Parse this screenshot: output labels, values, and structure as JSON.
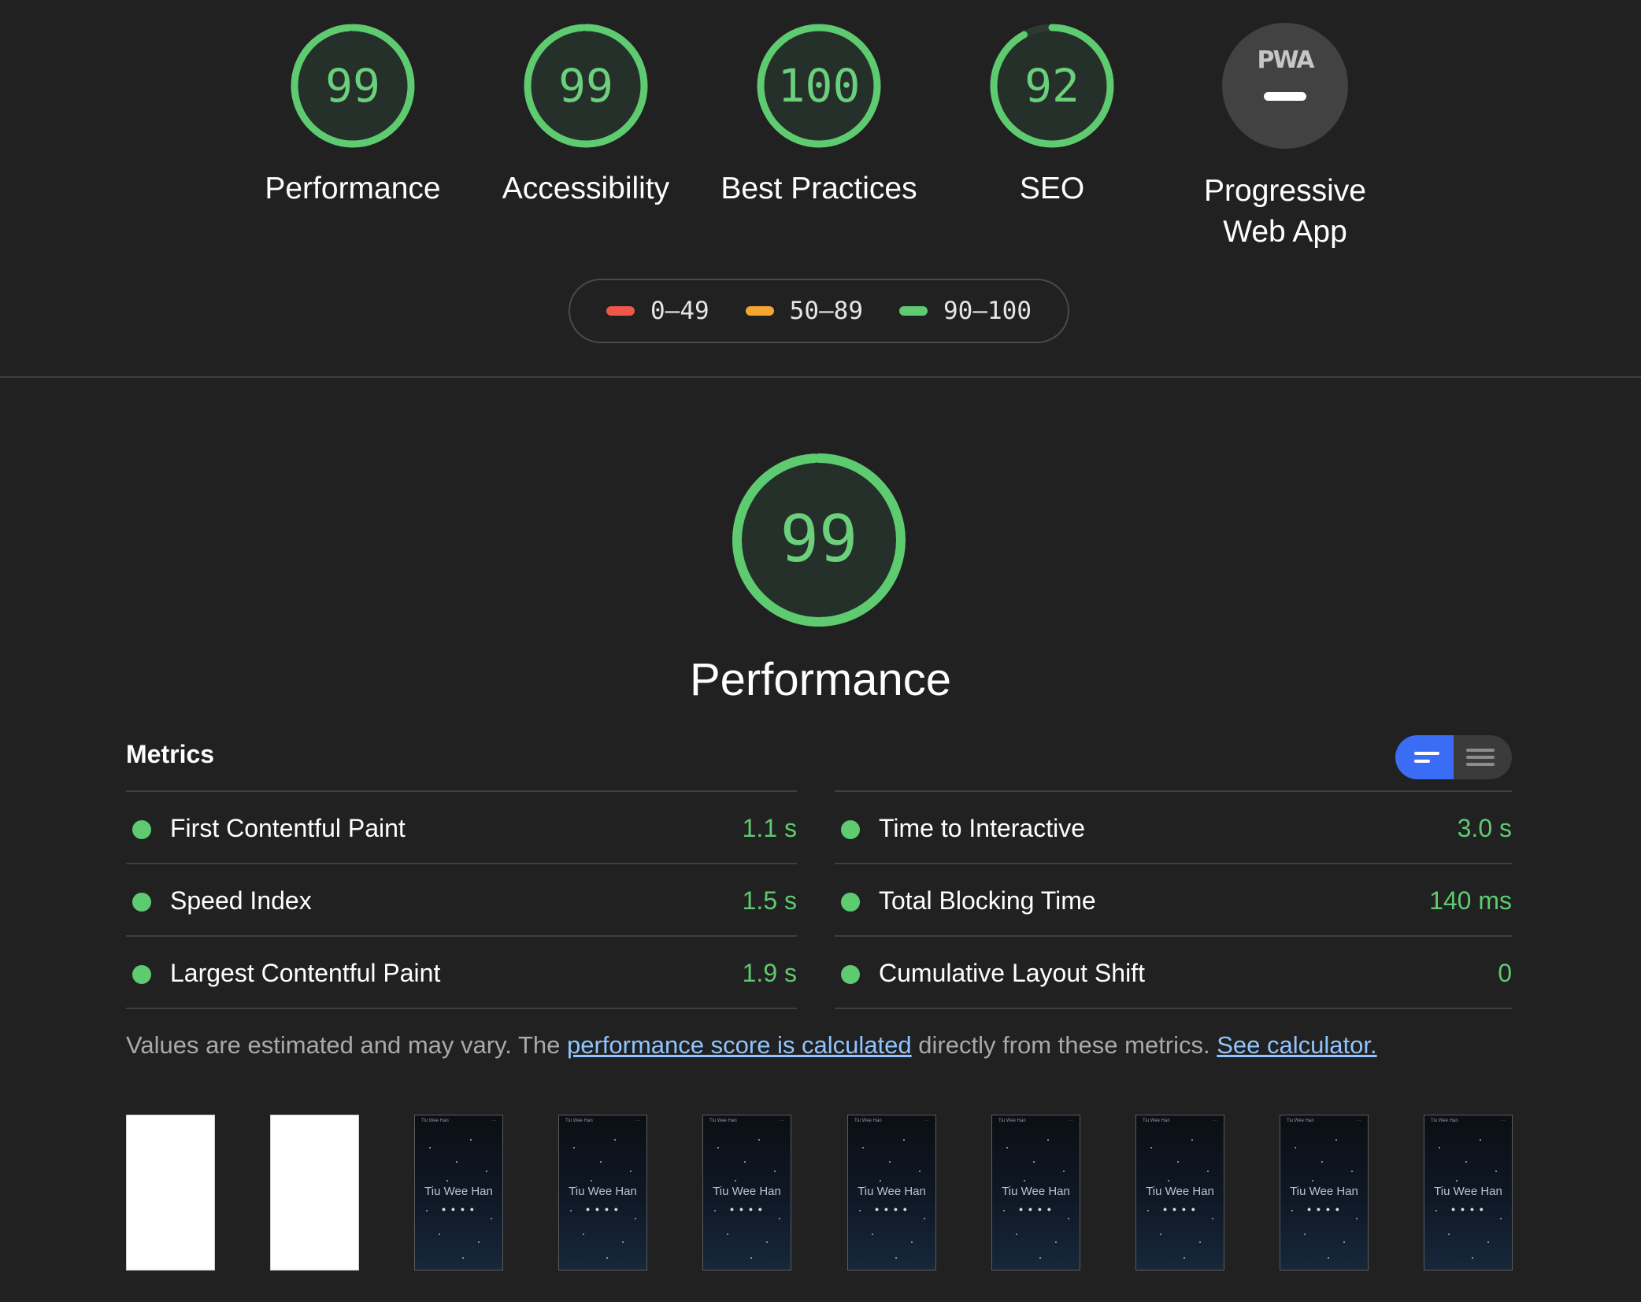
{
  "categories": [
    {
      "label": "Performance",
      "score": "99",
      "fraction": 0.99
    },
    {
      "label": "Accessibility",
      "score": "99",
      "fraction": 0.99
    },
    {
      "label": "Best Practices",
      "score": "100",
      "fraction": 1.0
    },
    {
      "label": "SEO",
      "score": "92",
      "fraction": 0.92
    }
  ],
  "pwa": {
    "logo": "PWA",
    "label_line1": "Progressive",
    "label_line2": "Web App"
  },
  "legend": [
    {
      "range": "0–49",
      "color": "#f0564a"
    },
    {
      "range": "50–89",
      "color": "#f5a531"
    },
    {
      "range": "90–100",
      "color": "#5ecb71"
    }
  ],
  "performance": {
    "score": "99",
    "fraction": 0.99,
    "title": "Performance"
  },
  "metrics": {
    "heading": "Metrics",
    "left": [
      {
        "name": "First Contentful Paint",
        "value": "1.1 s"
      },
      {
        "name": "Speed Index",
        "value": "1.5 s"
      },
      {
        "name": "Largest Contentful Paint",
        "value": "1.9 s"
      }
    ],
    "right": [
      {
        "name": "Time to Interactive",
        "value": "3.0 s"
      },
      {
        "name": "Total Blocking Time",
        "value": "140 ms"
      },
      {
        "name": "Cumulative Layout Shift",
        "value": "0"
      }
    ]
  },
  "note": {
    "part1": "Values are estimated and may vary. The ",
    "link1": "performance score is calculated",
    "part2": " directly from these metrics. ",
    "link2": "See calculator."
  },
  "filmstrip": {
    "site_name": "Tiu Wee Han",
    "site_header": "Tiu Wee Han",
    "menu_glyph": "···",
    "icons_glyph": "● ● ● ●",
    "frames": [
      "blank",
      "blank",
      "site",
      "site",
      "site",
      "site",
      "site",
      "site",
      "site",
      "site"
    ]
  },
  "colors": {
    "good": "#5ecb71",
    "good_track": "#26302a",
    "background": "#212121",
    "toggle_active": "#3b6cf6"
  }
}
